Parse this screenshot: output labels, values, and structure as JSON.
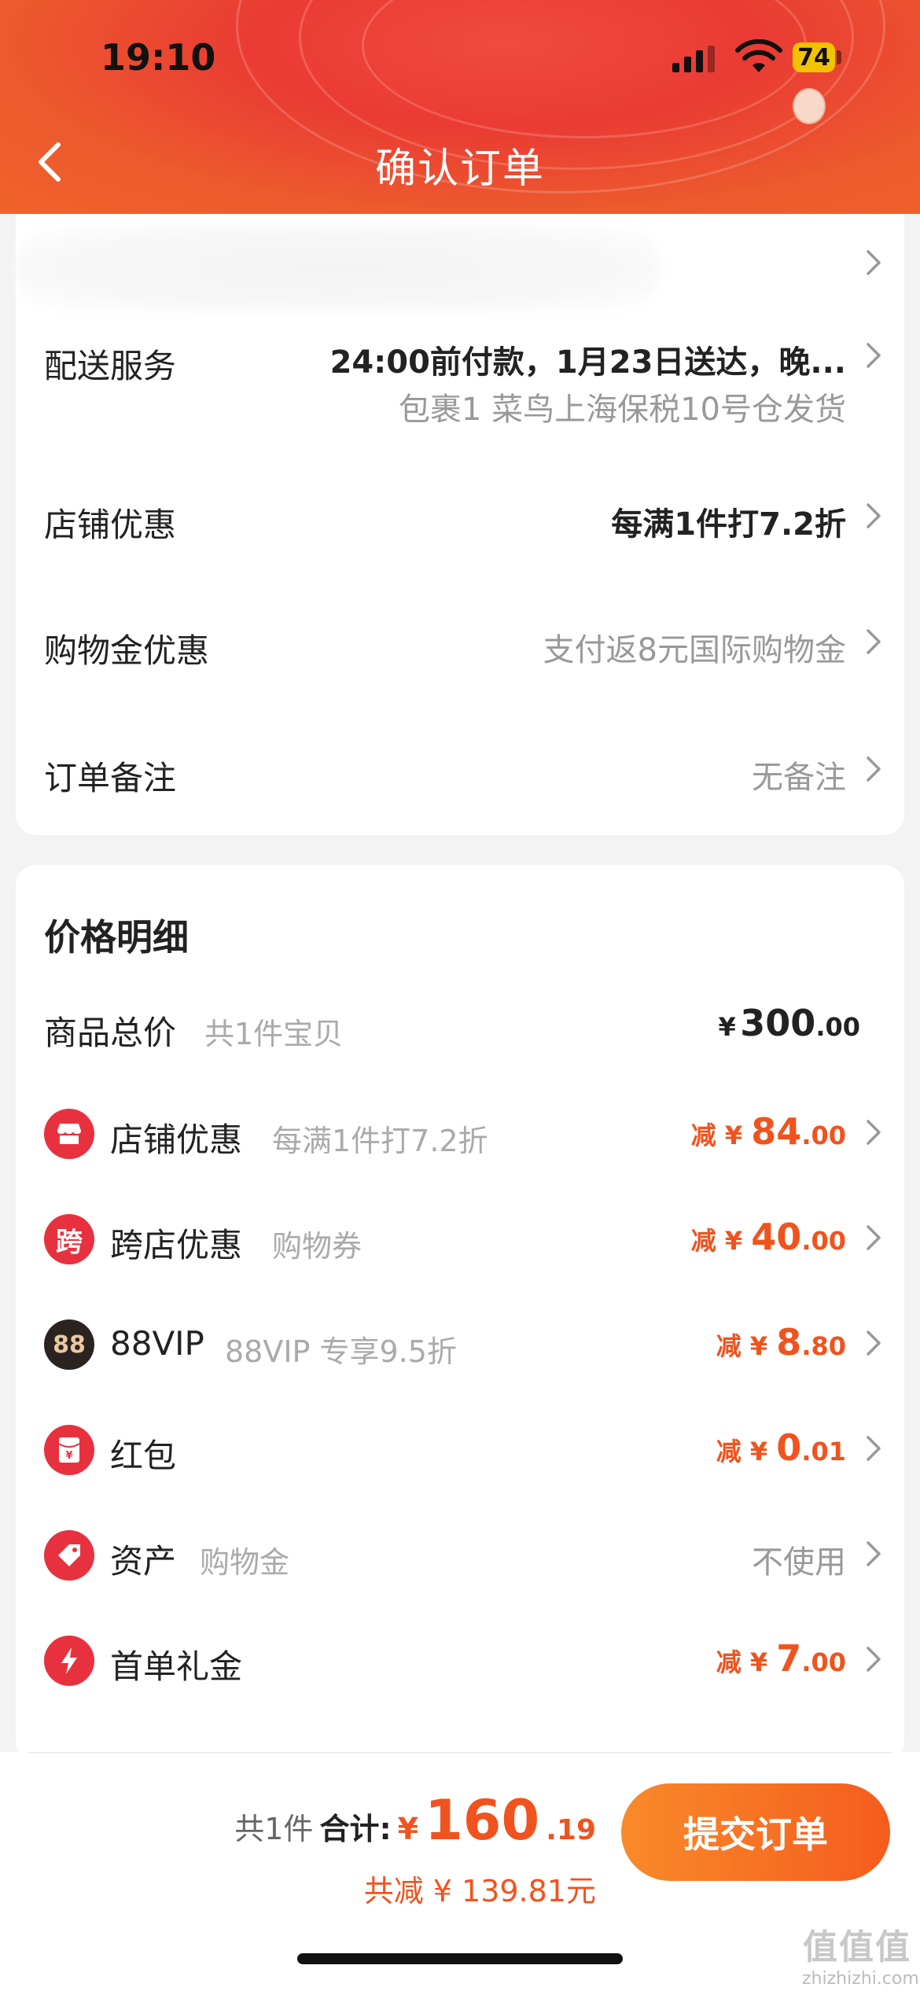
{
  "status_bar": {
    "time": "19:10",
    "battery": "74"
  },
  "header": {
    "title": "确认订单"
  },
  "order_rows": [
    {
      "label": "配送服务",
      "value": "24:00前付款，1月23日送达，晚...",
      "sub": "包裹1 菜鸟上海保税10号仓发货"
    },
    {
      "label": "店铺优惠",
      "value": "每满1件打7.2折"
    },
    {
      "label": "购物金优惠",
      "value": "支付返8元国际购物金"
    },
    {
      "label": "订单备注",
      "value": "无备注"
    }
  ],
  "price_detail": {
    "title": "价格明细",
    "total": {
      "label": "商品总价",
      "sub": "共1件宝贝",
      "yen": "¥",
      "int": "300",
      "dec": ".00"
    },
    "items": [
      {
        "icon": "store-icon",
        "icon_char": "🏪",
        "label": "店铺优惠",
        "sub": "每满1件打7.2折",
        "prefix": "减 ¥ ",
        "int": "84",
        "dec": ".00"
      },
      {
        "icon": "cross-store-icon",
        "icon_char": "跨",
        "label": "跨店优惠",
        "sub": "购物券",
        "prefix": "减 ¥ ",
        "int": "40",
        "dec": ".00"
      },
      {
        "icon": "vip-88-icon",
        "icon_char": "88",
        "label": "88VIP",
        "sub": "88VIP 专享9.5折",
        "prefix": "减 ¥ ",
        "int": "8",
        "dec": ".80"
      },
      {
        "icon": "red-packet-icon",
        "icon_char": "¥",
        "label": "红包",
        "sub": "",
        "prefix": "减 ¥ ",
        "int": "0",
        "dec": ".01"
      },
      {
        "icon": "asset-tag-icon",
        "icon_char": "◆",
        "label": "资产",
        "sub": "购物金",
        "plain": "不使用"
      },
      {
        "icon": "lightning-icon",
        "icon_char": "⚡",
        "label": "首单礼金",
        "sub": "",
        "prefix": "减 ¥ ",
        "int": "7",
        "dec": ".00"
      }
    ]
  },
  "footer": {
    "count": "共1件",
    "total_label": "合计:",
    "yen": "¥",
    "total_int": "160",
    "total_dec": ".19",
    "saved": "共减 ¥ 139.81元",
    "submit": "提交订单"
  },
  "watermark": {
    "logo": "值值值",
    "site": "zhizhizhi.com"
  },
  "colors": {
    "accent": "#f0531e",
    "header": "#ec4a32",
    "button_start": "#f98a2a",
    "button_end": "#f55c1e"
  }
}
